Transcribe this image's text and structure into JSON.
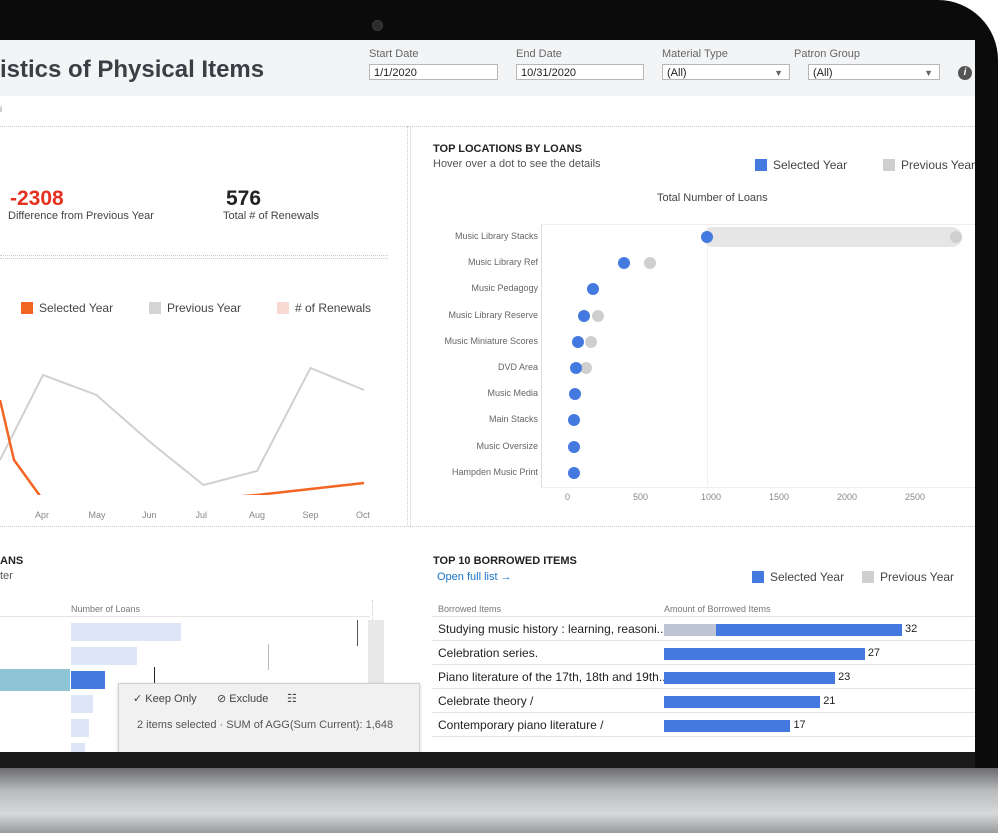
{
  "header": {
    "title": "istics of Physical Items",
    "crumb": "i"
  },
  "filters": {
    "start_date": {
      "label": "Start Date",
      "value": "1/1/2020"
    },
    "end_date": {
      "label": "End Date",
      "value": "10/31/2020"
    },
    "material_type": {
      "label": "Material Type",
      "value": "(All)"
    },
    "patron_group": {
      "label": "Patron Group",
      "value": "(All)"
    }
  },
  "kpis": {
    "difference": {
      "value": "-2308",
      "label": "Difference from Previous Year",
      "color": "#e5311f"
    },
    "renewals": {
      "value": "576",
      "label": "Total # of Renewals"
    }
  },
  "line_chart": {
    "legend": [
      "Selected Year",
      "Previous Year",
      "# of Renewals"
    ],
    "months": [
      "Apr",
      "May",
      "Jun",
      "Jul",
      "Aug",
      "Sep",
      "Oct"
    ]
  },
  "top_locations": {
    "title": "TOP LOCATIONS BY LOANS",
    "subtitle": "Hover over a dot to see the details",
    "legend_selected": "Selected Year",
    "legend_previous": "Previous Year",
    "axis_title": "Total Number of Loans",
    "ticks": [
      "0",
      "500",
      "1000",
      "1500",
      "2000",
      "2500"
    ]
  },
  "loans_panel": {
    "title": "ANS",
    "subtitle": "ter",
    "col_header": "Number of Loans"
  },
  "tooltip": {
    "keep_only": "Keep Only",
    "exclude": "Exclude",
    "summary": "2 items selected · SUM of AGG(Sum Current): 1,648"
  },
  "top_items": {
    "title": "TOP 10 BORROWED ITEMS",
    "link": "Open full list →",
    "legend_selected": "Selected Year",
    "legend_previous": "Previous Year",
    "col_items": "Borrowed Items",
    "col_amount": "Amount of Borrowed Items",
    "rows": [
      {
        "label": "Studying music history : learning, reasoni..",
        "value": "32"
      },
      {
        "label": "Celebration series.",
        "value": "27"
      },
      {
        "label": "Piano literature of the 17th, 18th and 19th..",
        "value": "23"
      },
      {
        "label": "Celebrate theory /",
        "value": "21"
      },
      {
        "label": "Contemporary piano literature /",
        "value": "17"
      }
    ]
  },
  "colors": {
    "selected_blue": "#4479e0",
    "previous_grey": "#cfcfcf",
    "selected_orange": "#f26522",
    "renewals_pink": "#f8d9d4"
  },
  "chart_data": [
    {
      "type": "line",
      "x": [
        "Apr",
        "May",
        "Jun",
        "Jul",
        "Aug",
        "Sep",
        "Oct"
      ],
      "series": [
        {
          "name": "Selected Year",
          "values": [
            20,
            20,
            20,
            21,
            25,
            31,
            37
          ]
        },
        {
          "name": "Previous Year",
          "values": [
            145,
            125,
            78,
            35,
            49,
            152,
            130
          ]
        }
      ]
    },
    {
      "type": "scatter",
      "title": "TOP LOCATIONS BY LOANS",
      "xlabel": "Total Number of Loans",
      "xlim": [
        0,
        2800
      ],
      "categories": [
        "Music Library Stacks",
        "Music Library Ref",
        "Music Pedagogy",
        "Music Library Reserve",
        "Music Miniature Scores",
        "DVD Area",
        "Music Media",
        "Main Stacks",
        "Music Oversize",
        "Hampden Music Print"
      ],
      "series": [
        {
          "name": "Selected Year",
          "values": [
            1000,
            390,
            160,
            95,
            50,
            40,
            30,
            25,
            25,
            20
          ]
        },
        {
          "name": "Previous Year",
          "values": [
            2830,
            580,
            160,
            200,
            150,
            110,
            30,
            25,
            25,
            20
          ]
        }
      ]
    },
    {
      "type": "bar",
      "title": "TOP 10 BORROWED ITEMS",
      "ylabel": "Amount of Borrowed Items",
      "categories": [
        "Studying music history : learning, reasoni..",
        "Celebration series.",
        "Piano literature of the 17th, 18th and 19th..",
        "Celebrate theory /",
        "Contemporary piano literature /"
      ],
      "series": [
        {
          "name": "Selected Year",
          "values": [
            32,
            27,
            23,
            21,
            17
          ]
        },
        {
          "name": "Previous Year",
          "values": [
            7,
            0,
            0,
            0,
            0
          ]
        }
      ]
    }
  ]
}
